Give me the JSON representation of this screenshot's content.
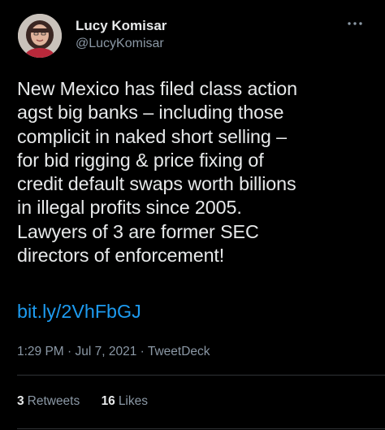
{
  "author": {
    "display_name": "Lucy Komisar",
    "handle": "@LucyKomisar"
  },
  "menu": {
    "icon": "more-horizontal-icon"
  },
  "tweet": {
    "lines": [
      "New Mexico has filed class action",
      "agst big banks – including those",
      "complicit in naked short selling –",
      "for bid rigging & price fixing of",
      "credit default swaps worth billions",
      "in illegal profits since 2005.",
      "Lawyers of 3 are former SEC",
      "directors of enforcement!"
    ],
    "link": "bit.ly/2VhFbGJ"
  },
  "meta": {
    "time": "1:29 PM",
    "date": "Jul 7, 2021",
    "source": "TweetDeck",
    "sep": " · "
  },
  "stats": {
    "retweets_count": "3",
    "retweets_label": "Retweets",
    "likes_count": "16",
    "likes_label": "Likes"
  },
  "colors": {
    "background": "#000000",
    "text": "#e7e9ea",
    "secondary": "#8b98a5",
    "link": "#1d9bf0",
    "divider": "#2f3336"
  }
}
